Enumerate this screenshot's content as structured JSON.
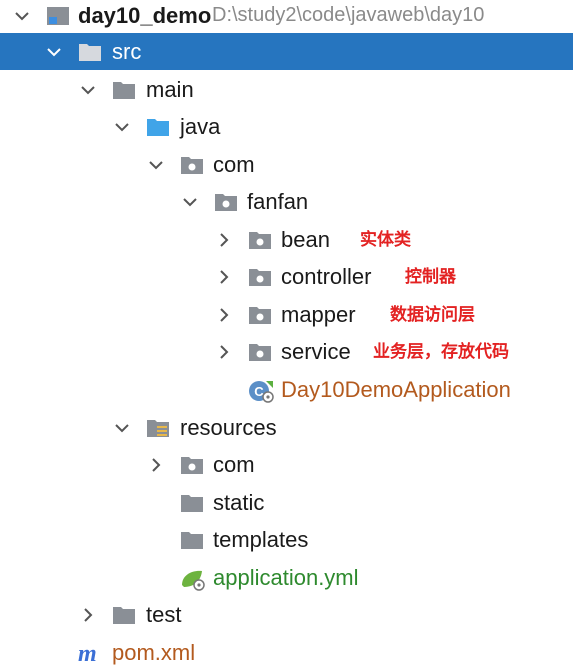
{
  "tree": {
    "root": {
      "name": "day10_demo",
      "path": "D:\\study2\\code\\javaweb\\day10"
    },
    "src": "src",
    "main": "main",
    "java": "java",
    "com": "com",
    "fanfan": "fanfan",
    "bean": {
      "name": "bean",
      "note": "实体类"
    },
    "controller": {
      "name": "controller",
      "note": "控制器"
    },
    "mapper": {
      "name": "mapper",
      "note": "数据访问层"
    },
    "service": {
      "name": "service",
      "note": "业务层，存放代码"
    },
    "app_class": "Day10DemoApplication",
    "resources": "resources",
    "res_com": "com",
    "static": "static",
    "templates": "templates",
    "app_yml": "application.yml",
    "test": "test",
    "pom": "pom.xml"
  },
  "colors": {
    "selection": "#2675bf",
    "annotation": "#e32222",
    "class_file": "#b35a1e",
    "yml_file": "#2e8a2e",
    "maven": "#3b6fd6"
  },
  "icons": {
    "folder": "folder-icon",
    "source_folder": "source-folder-icon",
    "resource_folder": "resource-folder-icon",
    "package": "package-icon",
    "spring_boot_class": "spring-boot-class-icon",
    "spring_yml": "spring-yml-icon",
    "maven": "maven-icon"
  }
}
